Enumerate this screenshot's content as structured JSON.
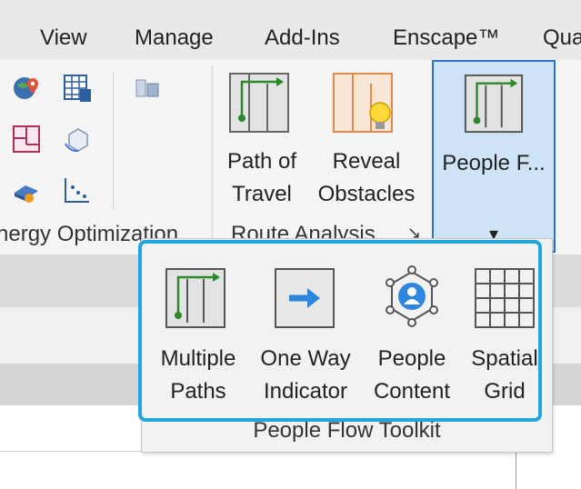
{
  "menu": {
    "tabs": [
      "View",
      "Manage",
      "Add-Ins",
      "Enscape™",
      "Qua"
    ]
  },
  "ribbon": {
    "energy_panel_label": "nergy Optimization",
    "route_panel_label": "Route Analysis",
    "route_panel_launcher": "↘",
    "path_of_travel": {
      "line1": "Path of",
      "line2": "Travel"
    },
    "reveal_obstacles": {
      "line1": "Reveal",
      "line2": "Obstacles"
    },
    "people_flow": {
      "label": "People F...",
      "dropdown": "▾"
    }
  },
  "flyout": {
    "title": "People Flow Toolkit",
    "items": [
      {
        "line1": "Multiple",
        "line2": "Paths",
        "icon": "multiple-paths-icon"
      },
      {
        "line1": "One Way",
        "line2": "Indicator",
        "icon": "arrow-right-icon"
      },
      {
        "line1": "People",
        "line2": "Content",
        "icon": "people-network-icon"
      },
      {
        "line1": "Spatial",
        "line2": "Grid",
        "icon": "grid-icon"
      }
    ]
  },
  "colors": {
    "highlight": "#1fa6dd",
    "active_button": "#cfe3f7",
    "active_border": "#2b73c9",
    "path_green": "#2a8a2a",
    "arrow_blue": "#2e86de"
  }
}
